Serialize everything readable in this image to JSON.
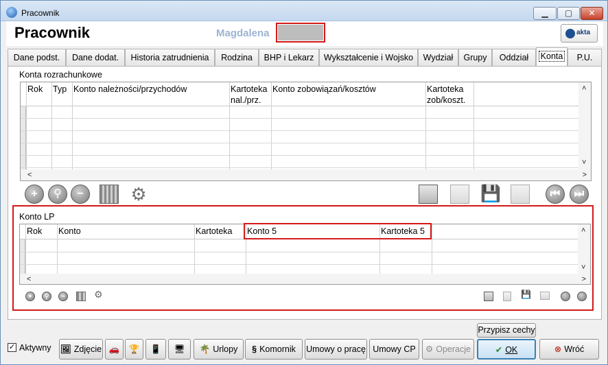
{
  "window": {
    "title": "Pracownik",
    "minimize": "▁",
    "maximize": "▢",
    "close": "✕"
  },
  "header": {
    "title": "Pracownik",
    "employee_name": "Magdalena",
    "logo_text": "akta"
  },
  "tabs": [
    {
      "label": "Dane podst."
    },
    {
      "label": "Dane dodat."
    },
    {
      "label": "Historia zatrudnienia"
    },
    {
      "label": "Rodzina"
    },
    {
      "label": "BHP i Lekarz"
    },
    {
      "label": "Wykształcenie i Wojsko"
    },
    {
      "label": "Wydział"
    },
    {
      "label": "Grupy"
    },
    {
      "label": "Oddział"
    },
    {
      "label": "Konta"
    },
    {
      "label": "P.U."
    }
  ],
  "konta_rozrachunkowe": {
    "label": "Konta rozrachunkowe",
    "columns": [
      "Rok",
      "Typ",
      "Konto należności/przychodów",
      "Kartoteka nal./prz.",
      "Konto zobowiązań/kosztów",
      "Kartoteka zob/koszt."
    ]
  },
  "konto_lp": {
    "label": "Konto LP",
    "columns": [
      "Rok",
      "Konto",
      "Kartoteka",
      "Konto 5",
      "Kartoteka 5"
    ]
  },
  "bottom": {
    "aktywny": "Aktywny",
    "zdjecie": "Zdjęcie",
    "urlopy": "Urlopy",
    "komornik": "Komornik",
    "umowy_o_prace": "Umowy o pracę",
    "umowy_cp": "Umowy CP",
    "operacje": "Operacje",
    "przypisz_cechy": "Przypisz cechy",
    "ok": "OK",
    "wroc": "Wróć"
  }
}
